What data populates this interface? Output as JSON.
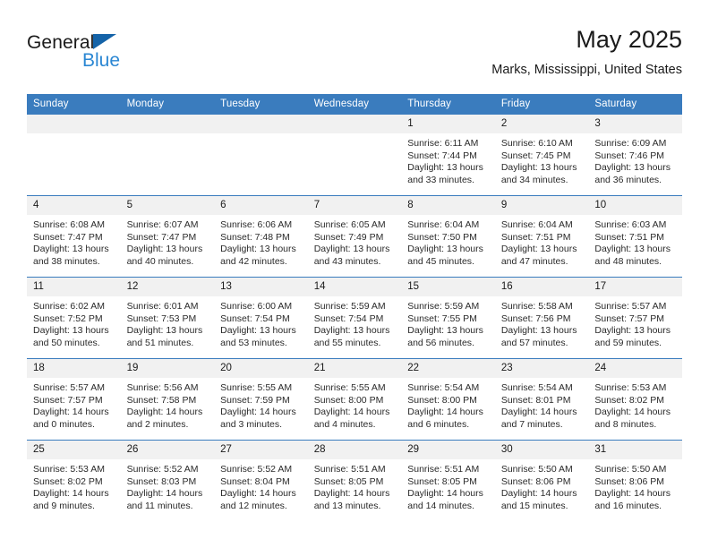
{
  "brand": {
    "name_part1": "General",
    "name_part2": "Blue",
    "logo_icon": "triangle-logo-icon"
  },
  "header": {
    "title": "May 2025",
    "subtitle": "Marks, Mississippi, United States"
  },
  "calendar": {
    "weekday_headers": [
      "Sunday",
      "Monday",
      "Tuesday",
      "Wednesday",
      "Thursday",
      "Friday",
      "Saturday"
    ],
    "accent_color": "#3a7cbe",
    "daynum_band_color": "#f1f1f1",
    "weeks": [
      [
        {
          "day": "",
          "empty": true,
          "sunrise": "",
          "sunset": "",
          "daylight_line1": "",
          "daylight_line2": ""
        },
        {
          "day": "",
          "empty": true,
          "sunrise": "",
          "sunset": "",
          "daylight_line1": "",
          "daylight_line2": ""
        },
        {
          "day": "",
          "empty": true,
          "sunrise": "",
          "sunset": "",
          "daylight_line1": "",
          "daylight_line2": ""
        },
        {
          "day": "",
          "empty": true,
          "sunrise": "",
          "sunset": "",
          "daylight_line1": "",
          "daylight_line2": ""
        },
        {
          "day": "1",
          "empty": false,
          "sunrise": "Sunrise: 6:11 AM",
          "sunset": "Sunset: 7:44 PM",
          "daylight_line1": "Daylight: 13 hours",
          "daylight_line2": "and 33 minutes."
        },
        {
          "day": "2",
          "empty": false,
          "sunrise": "Sunrise: 6:10 AM",
          "sunset": "Sunset: 7:45 PM",
          "daylight_line1": "Daylight: 13 hours",
          "daylight_line2": "and 34 minutes."
        },
        {
          "day": "3",
          "empty": false,
          "sunrise": "Sunrise: 6:09 AM",
          "sunset": "Sunset: 7:46 PM",
          "daylight_line1": "Daylight: 13 hours",
          "daylight_line2": "and 36 minutes."
        }
      ],
      [
        {
          "day": "4",
          "empty": false,
          "sunrise": "Sunrise: 6:08 AM",
          "sunset": "Sunset: 7:47 PM",
          "daylight_line1": "Daylight: 13 hours",
          "daylight_line2": "and 38 minutes."
        },
        {
          "day": "5",
          "empty": false,
          "sunrise": "Sunrise: 6:07 AM",
          "sunset": "Sunset: 7:47 PM",
          "daylight_line1": "Daylight: 13 hours",
          "daylight_line2": "and 40 minutes."
        },
        {
          "day": "6",
          "empty": false,
          "sunrise": "Sunrise: 6:06 AM",
          "sunset": "Sunset: 7:48 PM",
          "daylight_line1": "Daylight: 13 hours",
          "daylight_line2": "and 42 minutes."
        },
        {
          "day": "7",
          "empty": false,
          "sunrise": "Sunrise: 6:05 AM",
          "sunset": "Sunset: 7:49 PM",
          "daylight_line1": "Daylight: 13 hours",
          "daylight_line2": "and 43 minutes."
        },
        {
          "day": "8",
          "empty": false,
          "sunrise": "Sunrise: 6:04 AM",
          "sunset": "Sunset: 7:50 PM",
          "daylight_line1": "Daylight: 13 hours",
          "daylight_line2": "and 45 minutes."
        },
        {
          "day": "9",
          "empty": false,
          "sunrise": "Sunrise: 6:04 AM",
          "sunset": "Sunset: 7:51 PM",
          "daylight_line1": "Daylight: 13 hours",
          "daylight_line2": "and 47 minutes."
        },
        {
          "day": "10",
          "empty": false,
          "sunrise": "Sunrise: 6:03 AM",
          "sunset": "Sunset: 7:51 PM",
          "daylight_line1": "Daylight: 13 hours",
          "daylight_line2": "and 48 minutes."
        }
      ],
      [
        {
          "day": "11",
          "empty": false,
          "sunrise": "Sunrise: 6:02 AM",
          "sunset": "Sunset: 7:52 PM",
          "daylight_line1": "Daylight: 13 hours",
          "daylight_line2": "and 50 minutes."
        },
        {
          "day": "12",
          "empty": false,
          "sunrise": "Sunrise: 6:01 AM",
          "sunset": "Sunset: 7:53 PM",
          "daylight_line1": "Daylight: 13 hours",
          "daylight_line2": "and 51 minutes."
        },
        {
          "day": "13",
          "empty": false,
          "sunrise": "Sunrise: 6:00 AM",
          "sunset": "Sunset: 7:54 PM",
          "daylight_line1": "Daylight: 13 hours",
          "daylight_line2": "and 53 minutes."
        },
        {
          "day": "14",
          "empty": false,
          "sunrise": "Sunrise: 5:59 AM",
          "sunset": "Sunset: 7:54 PM",
          "daylight_line1": "Daylight: 13 hours",
          "daylight_line2": "and 55 minutes."
        },
        {
          "day": "15",
          "empty": false,
          "sunrise": "Sunrise: 5:59 AM",
          "sunset": "Sunset: 7:55 PM",
          "daylight_line1": "Daylight: 13 hours",
          "daylight_line2": "and 56 minutes."
        },
        {
          "day": "16",
          "empty": false,
          "sunrise": "Sunrise: 5:58 AM",
          "sunset": "Sunset: 7:56 PM",
          "daylight_line1": "Daylight: 13 hours",
          "daylight_line2": "and 57 minutes."
        },
        {
          "day": "17",
          "empty": false,
          "sunrise": "Sunrise: 5:57 AM",
          "sunset": "Sunset: 7:57 PM",
          "daylight_line1": "Daylight: 13 hours",
          "daylight_line2": "and 59 minutes."
        }
      ],
      [
        {
          "day": "18",
          "empty": false,
          "sunrise": "Sunrise: 5:57 AM",
          "sunset": "Sunset: 7:57 PM",
          "daylight_line1": "Daylight: 14 hours",
          "daylight_line2": "and 0 minutes."
        },
        {
          "day": "19",
          "empty": false,
          "sunrise": "Sunrise: 5:56 AM",
          "sunset": "Sunset: 7:58 PM",
          "daylight_line1": "Daylight: 14 hours",
          "daylight_line2": "and 2 minutes."
        },
        {
          "day": "20",
          "empty": false,
          "sunrise": "Sunrise: 5:55 AM",
          "sunset": "Sunset: 7:59 PM",
          "daylight_line1": "Daylight: 14 hours",
          "daylight_line2": "and 3 minutes."
        },
        {
          "day": "21",
          "empty": false,
          "sunrise": "Sunrise: 5:55 AM",
          "sunset": "Sunset: 8:00 PM",
          "daylight_line1": "Daylight: 14 hours",
          "daylight_line2": "and 4 minutes."
        },
        {
          "day": "22",
          "empty": false,
          "sunrise": "Sunrise: 5:54 AM",
          "sunset": "Sunset: 8:00 PM",
          "daylight_line1": "Daylight: 14 hours",
          "daylight_line2": "and 6 minutes."
        },
        {
          "day": "23",
          "empty": false,
          "sunrise": "Sunrise: 5:54 AM",
          "sunset": "Sunset: 8:01 PM",
          "daylight_line1": "Daylight: 14 hours",
          "daylight_line2": "and 7 minutes."
        },
        {
          "day": "24",
          "empty": false,
          "sunrise": "Sunrise: 5:53 AM",
          "sunset": "Sunset: 8:02 PM",
          "daylight_line1": "Daylight: 14 hours",
          "daylight_line2": "and 8 minutes."
        }
      ],
      [
        {
          "day": "25",
          "empty": false,
          "sunrise": "Sunrise: 5:53 AM",
          "sunset": "Sunset: 8:02 PM",
          "daylight_line1": "Daylight: 14 hours",
          "daylight_line2": "and 9 minutes."
        },
        {
          "day": "26",
          "empty": false,
          "sunrise": "Sunrise: 5:52 AM",
          "sunset": "Sunset: 8:03 PM",
          "daylight_line1": "Daylight: 14 hours",
          "daylight_line2": "and 11 minutes."
        },
        {
          "day": "27",
          "empty": false,
          "sunrise": "Sunrise: 5:52 AM",
          "sunset": "Sunset: 8:04 PM",
          "daylight_line1": "Daylight: 14 hours",
          "daylight_line2": "and 12 minutes."
        },
        {
          "day": "28",
          "empty": false,
          "sunrise": "Sunrise: 5:51 AM",
          "sunset": "Sunset: 8:05 PM",
          "daylight_line1": "Daylight: 14 hours",
          "daylight_line2": "and 13 minutes."
        },
        {
          "day": "29",
          "empty": false,
          "sunrise": "Sunrise: 5:51 AM",
          "sunset": "Sunset: 8:05 PM",
          "daylight_line1": "Daylight: 14 hours",
          "daylight_line2": "and 14 minutes."
        },
        {
          "day": "30",
          "empty": false,
          "sunrise": "Sunrise: 5:50 AM",
          "sunset": "Sunset: 8:06 PM",
          "daylight_line1": "Daylight: 14 hours",
          "daylight_line2": "and 15 minutes."
        },
        {
          "day": "31",
          "empty": false,
          "sunrise": "Sunrise: 5:50 AM",
          "sunset": "Sunset: 8:06 PM",
          "daylight_line1": "Daylight: 14 hours",
          "daylight_line2": "and 16 minutes."
        }
      ]
    ]
  }
}
